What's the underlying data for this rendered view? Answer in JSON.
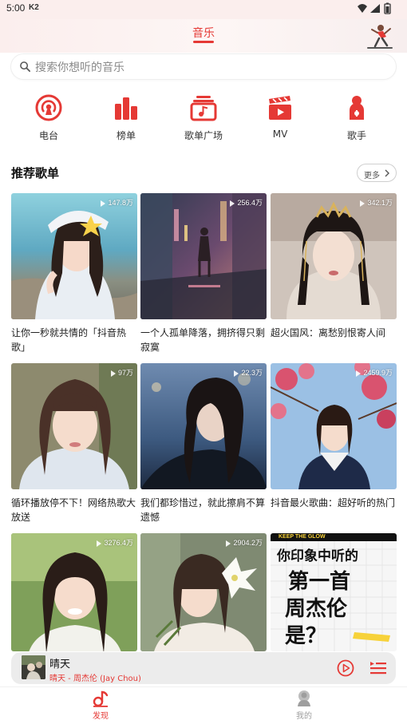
{
  "status_bar": {
    "time": "5:00",
    "carrier": "K2"
  },
  "header": {
    "active_tab": "音乐"
  },
  "search": {
    "placeholder": "搜索你想听的音乐"
  },
  "nav": [
    {
      "label": "电台",
      "icon": "radio-icon"
    },
    {
      "label": "榜单",
      "icon": "chart-icon"
    },
    {
      "label": "歌单广场",
      "icon": "playlist-icon"
    },
    {
      "label": "MV",
      "icon": "mv-icon"
    },
    {
      "label": "歌手",
      "icon": "singer-icon"
    }
  ],
  "section": {
    "title": "推荐歌单",
    "more": "更多"
  },
  "playlists": [
    {
      "title": "让你一秒就共情的「抖音热歌」",
      "plays": "147.8万"
    },
    {
      "title": "一个人孤单降落，拥挤得只剩寂寞",
      "plays": "256.4万"
    },
    {
      "title": "超火国风：离愁别恨寄人间",
      "plays": "342.1万"
    },
    {
      "title": "循环播放停不下！网络热歌大放送",
      "plays": "97万"
    },
    {
      "title": "我们都珍惜过，就此擦肩不算遗憾",
      "plays": "22.3万"
    },
    {
      "title": "抖音最火歌曲：超好听的热门",
      "plays": "2459.9万"
    },
    {
      "title": "",
      "plays": "3276.4万"
    },
    {
      "title": "",
      "plays": "2904.2万"
    },
    {
      "title": "",
      "plays": "",
      "cover_text": {
        "banner": "KEEP THE GLOW",
        "line1": "你印象中听的",
        "line2": "第一首",
        "line3": "周杰伦",
        "line4": "是？"
      }
    }
  ],
  "player": {
    "title": "晴天",
    "subtitle": "晴天 - 周杰伦 (Jay Chou)"
  },
  "bottom_nav": [
    {
      "label": "发现",
      "active": true
    },
    {
      "label": "我的",
      "active": false
    }
  ],
  "colors": {
    "accent": "#e53935",
    "inactive": "#9e9e9e"
  }
}
